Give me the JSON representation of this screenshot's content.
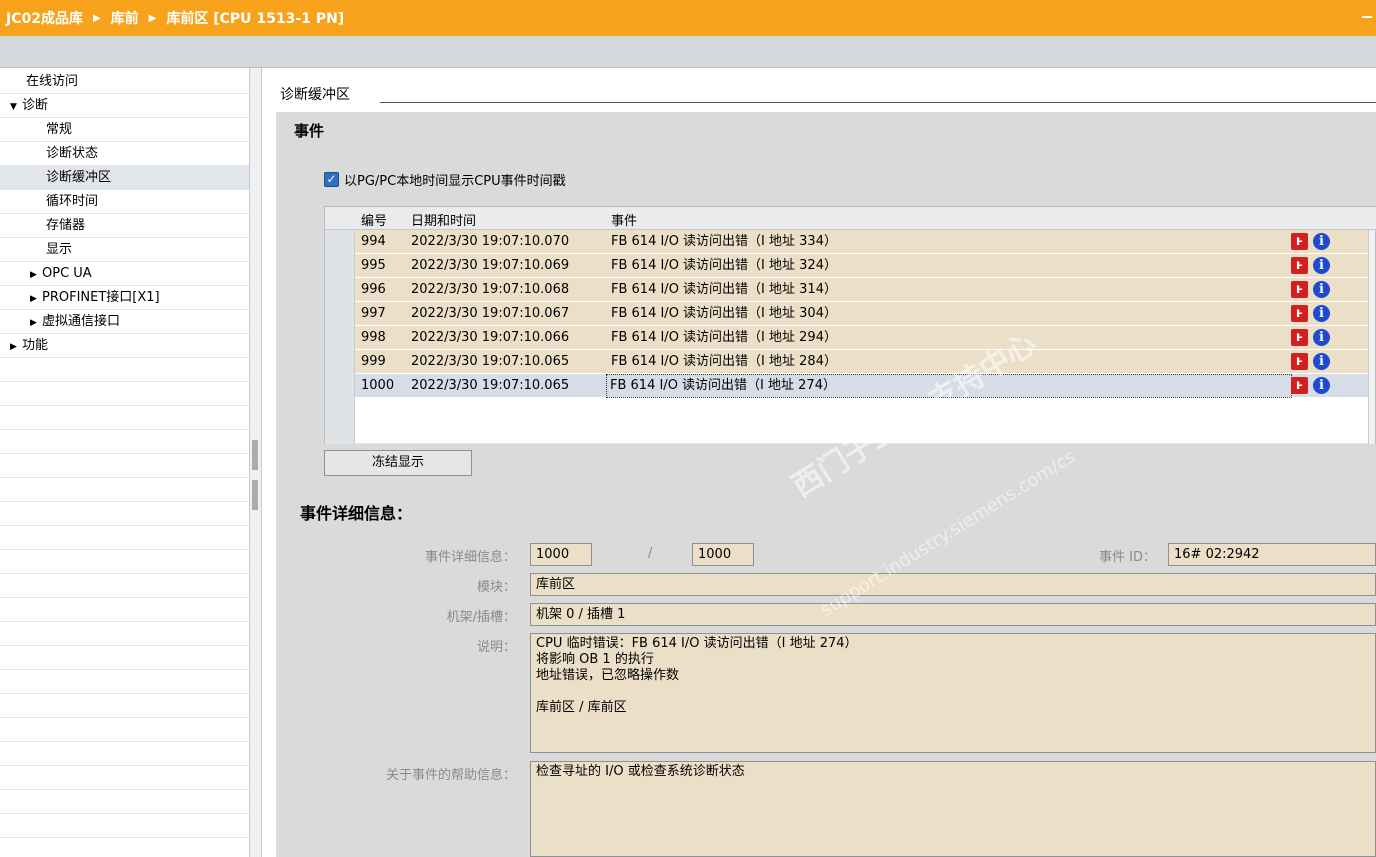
{
  "window": {
    "breadcrumb": [
      "JC02成品库",
      "库前",
      "库前区 [CPU 1513-1 PN]"
    ]
  },
  "nav": {
    "items": [
      {
        "label": "在线访问",
        "arrow": ""
      },
      {
        "label": "诊断",
        "arrow": "▼"
      },
      {
        "label": "常规",
        "arrow": ""
      },
      {
        "label": "诊断状态",
        "arrow": ""
      },
      {
        "label": "诊断缓冲区",
        "arrow": "",
        "selected": true
      },
      {
        "label": "循环时间",
        "arrow": ""
      },
      {
        "label": "存储器",
        "arrow": ""
      },
      {
        "label": "显示",
        "arrow": ""
      },
      {
        "label": "OPC UA",
        "arrow": "▶"
      },
      {
        "label": "PROFINET接口[X1]",
        "arrow": "▶"
      },
      {
        "label": "虚拟通信接口",
        "arrow": "▶"
      },
      {
        "label": "功能",
        "arrow": "▶"
      }
    ]
  },
  "main": {
    "section_title": "诊断缓冲区",
    "events_title": "事件",
    "checkbox_label": "以PG/PC本地时间显示CPU事件时间戳",
    "checkbox_checked": true,
    "table": {
      "headers": {
        "num": "编号",
        "datetime": "日期和时间",
        "event": "事件"
      },
      "rows": [
        {
          "num": "994",
          "datetime": "2022/3/30 19:07:10.070",
          "event": "FB 614  I/O 读访问出错（I 地址 334）"
        },
        {
          "num": "995",
          "datetime": "2022/3/30 19:07:10.069",
          "event": "FB 614  I/O 读访问出错（I 地址 324）"
        },
        {
          "num": "996",
          "datetime": "2022/3/30 19:07:10.068",
          "event": "FB 614  I/O 读访问出错（I 地址 314）"
        },
        {
          "num": "997",
          "datetime": "2022/3/30 19:07:10.067",
          "event": "FB 614  I/O 读访问出错（I 地址 304）"
        },
        {
          "num": "998",
          "datetime": "2022/3/30 19:07:10.066",
          "event": "FB 614  I/O 读访问出错（I 地址 294）"
        },
        {
          "num": "999",
          "datetime": "2022/3/30 19:07:10.065",
          "event": "FB 614  I/O 读访问出错（I 地址 284）"
        },
        {
          "num": "1000",
          "datetime": "2022/3/30 19:07:10.065",
          "event": "FB 614  I/O 读访问出错（I 地址 274）"
        }
      ],
      "icons": {
        "wrench": "wrench-icon",
        "info": "info-icon"
      }
    },
    "freeze_button": "冻结显示",
    "details": {
      "title": "事件详细信息：",
      "detail_label": "事件详细信息：",
      "detail_value": "1000",
      "slash": "/",
      "detail_total": "1000",
      "event_id_label": "事件 ID：",
      "event_id_value": "16# 02:2942",
      "module_label": "模块：",
      "module_value": "库前区",
      "rack_label": "机架/插槽：",
      "rack_value": "机架 0 / 插槽 1",
      "desc_label": "说明：",
      "desc_value": "CPU 临时错误：FB 614  I/O 读访问出错（I 地址 274）\n将影响 OB 1 的执行\n地址错误，已忽略操作数\n\n库前区 / 库前区",
      "help_label": "关于事件的帮助信息：",
      "help_value": "检查寻址的 I/O 或检查系统诊断状态"
    },
    "watermark": {
      "line1": "西门子工业  支持中心",
      "line2": "support.industry.siemens.com/cs"
    }
  },
  "colors": {
    "titlebar": "#f7a21b",
    "row_bg": "#ecdfc8",
    "selected_row": "#d6dde6"
  }
}
